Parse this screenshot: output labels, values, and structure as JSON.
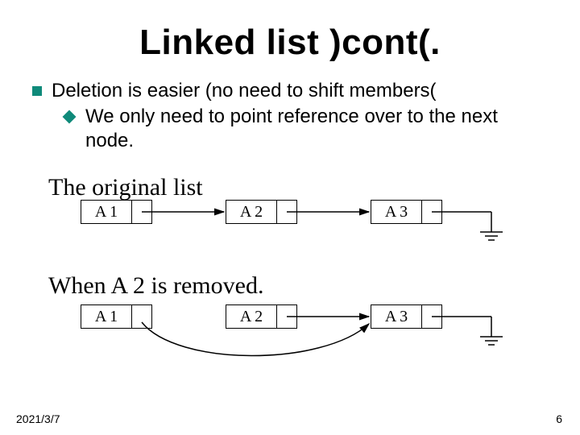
{
  "title": "Linked list )cont(.",
  "bullets": {
    "b1": "Deletion is easier (no need to shift members(",
    "b2": "We only need to point reference over to the next node."
  },
  "sub1": "The original list",
  "sub2": "When A 2 is removed.",
  "row1": {
    "n1": "A 1",
    "n2": "A 2",
    "n3": "A 3"
  },
  "row2": {
    "n1": "A 1",
    "n2": "A 2",
    "n3": "A 3"
  },
  "date": "2021/3/7",
  "pagenum": "6"
}
